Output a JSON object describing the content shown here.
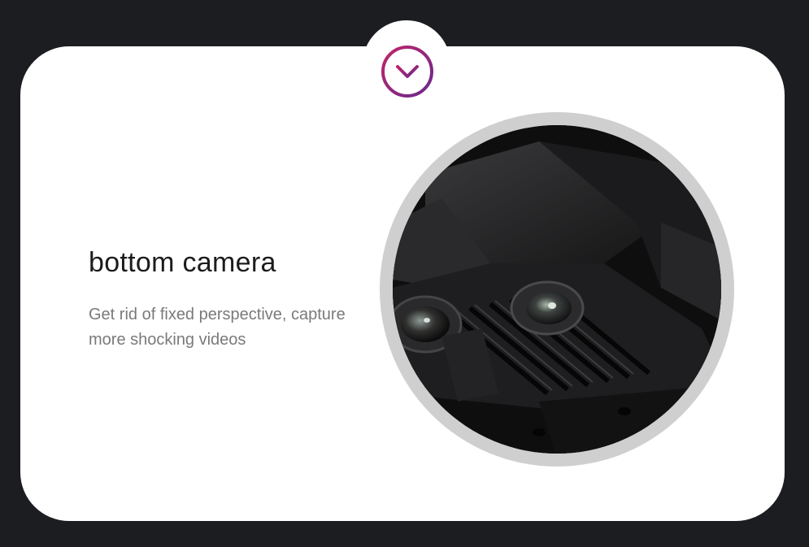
{
  "feature": {
    "title": "bottom camera",
    "description": "Get rid of fixed perspective, capture more shocking videos"
  },
  "icons": {
    "toggle": "chevron-down-icon",
    "photo": "drone-bottom-camera-photo"
  },
  "colors": {
    "background": "#1c1d21",
    "card": "#ffffff",
    "accent_start": "#b5246b",
    "accent_end": "#6a2a8c",
    "ring": "#cfcfcf",
    "title": "#1c1c1c",
    "description": "#7a7a7a"
  }
}
